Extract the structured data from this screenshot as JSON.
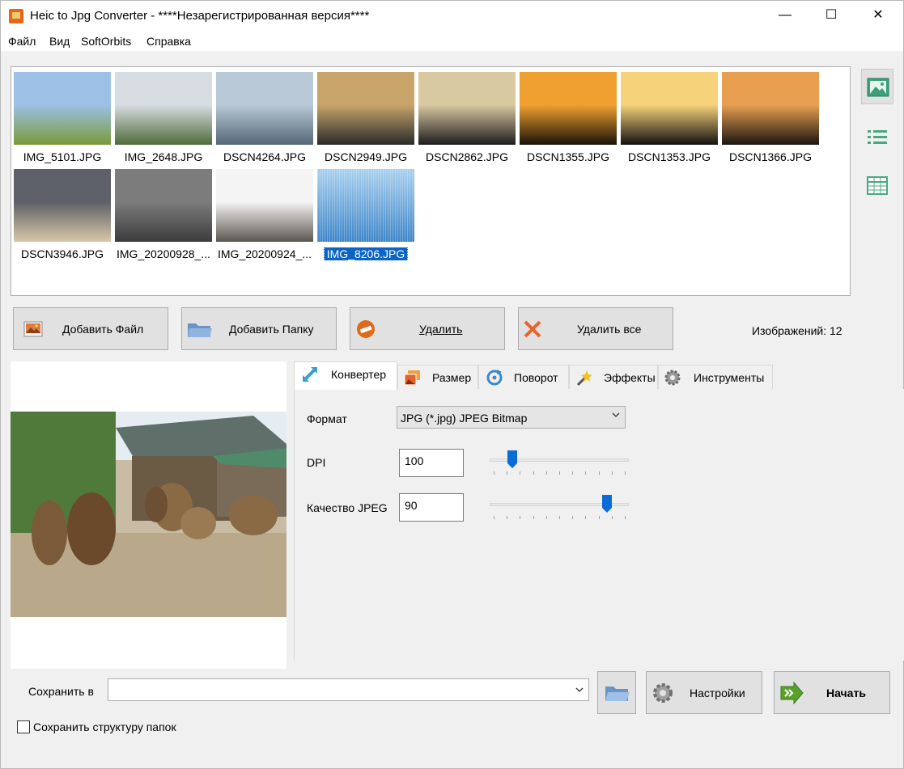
{
  "window": {
    "title": "Heic to Jpg Converter - ****Незарегистрированная версия****",
    "minimize": "—",
    "maximize": "☐",
    "close": "✕"
  },
  "menu": [
    "Файл",
    "Вид",
    "SoftOrbits",
    "Справка"
  ],
  "thumbnails": [
    {
      "name": "IMG_5101.JPG",
      "colors": [
        "#9cc0e6",
        "#7a9a3a"
      ]
    },
    {
      "name": "IMG_2648.JPG",
      "colors": [
        "#d7dde2",
        "#4f6b3a"
      ]
    },
    {
      "name": "DSCN4264.JPG",
      "colors": [
        "#b9c9d8",
        "#556676"
      ]
    },
    {
      "name": "DSCN2949.JPG",
      "colors": [
        "#c8a46a",
        "#2a2a2a"
      ]
    },
    {
      "name": "DSCN2862.JPG",
      "colors": [
        "#d9c9a0",
        "#1d1d1d"
      ]
    },
    {
      "name": "DSCN1355.JPG",
      "colors": [
        "#f0a030",
        "#1a1208"
      ]
    },
    {
      "name": "DSCN1353.JPG",
      "colors": [
        "#f6d37a",
        "#141010"
      ]
    },
    {
      "name": "DSCN1366.JPG",
      "colors": [
        "#e8a050",
        "#1b1510"
      ]
    },
    {
      "name": "DSCN3946.JPG",
      "colors": [
        "#5d6068",
        "#d8c8a8"
      ]
    },
    {
      "name": "IMG_20200928_...",
      "colors": [
        "#7c7c7c",
        "#3c3c3c"
      ]
    },
    {
      "name": "IMG_20200924_...",
      "colors": [
        "#f4f4f4",
        "#5c5650"
      ]
    },
    {
      "name": "IMG_8206.JPG",
      "colors": [
        "#3d85c8",
        "#a9d0ee"
      ],
      "selected": true
    }
  ],
  "toolbar": {
    "add_file": "Добавить Файл",
    "add_folder": "Добавить Папку",
    "delete": "Удалить",
    "delete_all": "Удалить все",
    "count_label": "Изображений: 12"
  },
  "tabs": [
    "Конвертер",
    "Размер",
    "Поворот",
    "Эффекты",
    "Инструменты"
  ],
  "converter": {
    "format_label": "Формат",
    "format_value": "JPG (*.jpg) JPEG Bitmap",
    "dpi_label": "DPI",
    "dpi_value": "100",
    "dpi_slider_fraction": 0.14,
    "quality_label": "Качество JPEG",
    "quality_value": "90",
    "quality_slider_fraction": 0.87
  },
  "bottom": {
    "save_label": "Сохранить в",
    "save_path": "",
    "settings": "Настройки",
    "start": "Начать",
    "keep_structure": "Сохранить структуру папок"
  },
  "colors": {
    "selection": "#0a64c8",
    "button_bg": "#e1e1e1",
    "slider_thumb": "#0a6cd6",
    "start_arrow": "#5aa02c"
  }
}
